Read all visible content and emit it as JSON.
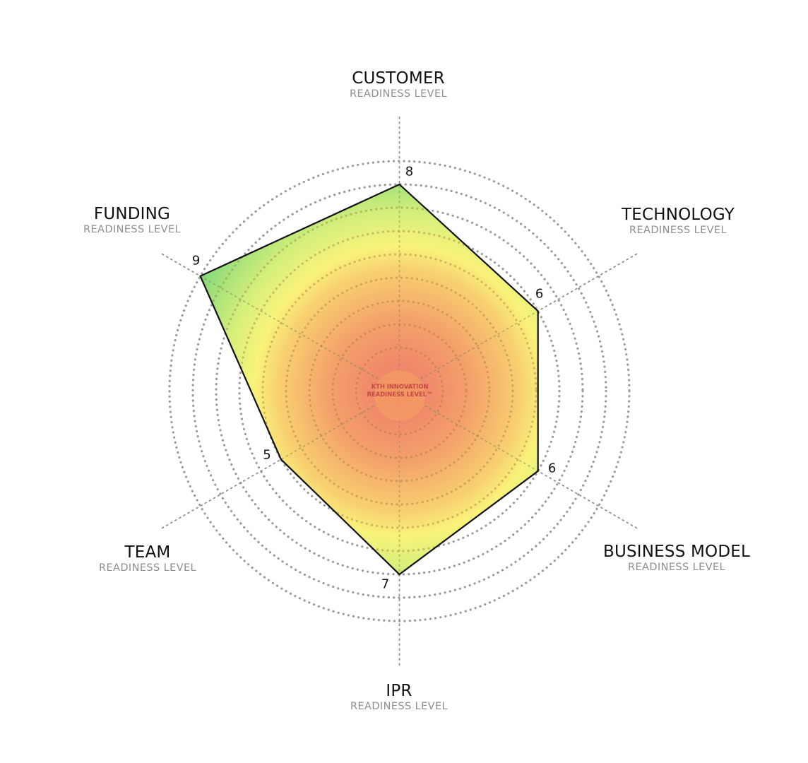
{
  "chart_data": {
    "type": "radar",
    "title": "KTH Innovation Readiness Level™",
    "center_label": [
      "KTH INNOVATION",
      "READINESS LEVEL™"
    ],
    "scale": {
      "min": 0,
      "max": 9,
      "rings": 9,
      "grid": "dotted circles"
    },
    "axes": [
      {
        "key": "customer",
        "title": "CUSTOMER",
        "subtitle": "READINESS LEVEL",
        "value": 8
      },
      {
        "key": "technology",
        "title": "TECHNOLOGY",
        "subtitle": "READINESS LEVEL",
        "value": 6
      },
      {
        "key": "business",
        "title": "BUSINESS MODEL",
        "subtitle": "READINESS LEVEL",
        "value": 6
      },
      {
        "key": "ipr",
        "title": "IPR",
        "subtitle": "READINESS LEVEL",
        "value": 7
      },
      {
        "key": "team",
        "title": "TEAM",
        "subtitle": "READINESS LEVEL",
        "value": 5
      },
      {
        "key": "funding",
        "title": "FUNDING",
        "subtitle": "READINESS LEVEL",
        "value": 9
      }
    ],
    "fill_gradient": [
      "#ee7b6b",
      "#f4a36a",
      "#f9e976",
      "#f7f678",
      "#c6ee7a",
      "#86d97b"
    ],
    "outline_color": "#111111"
  }
}
